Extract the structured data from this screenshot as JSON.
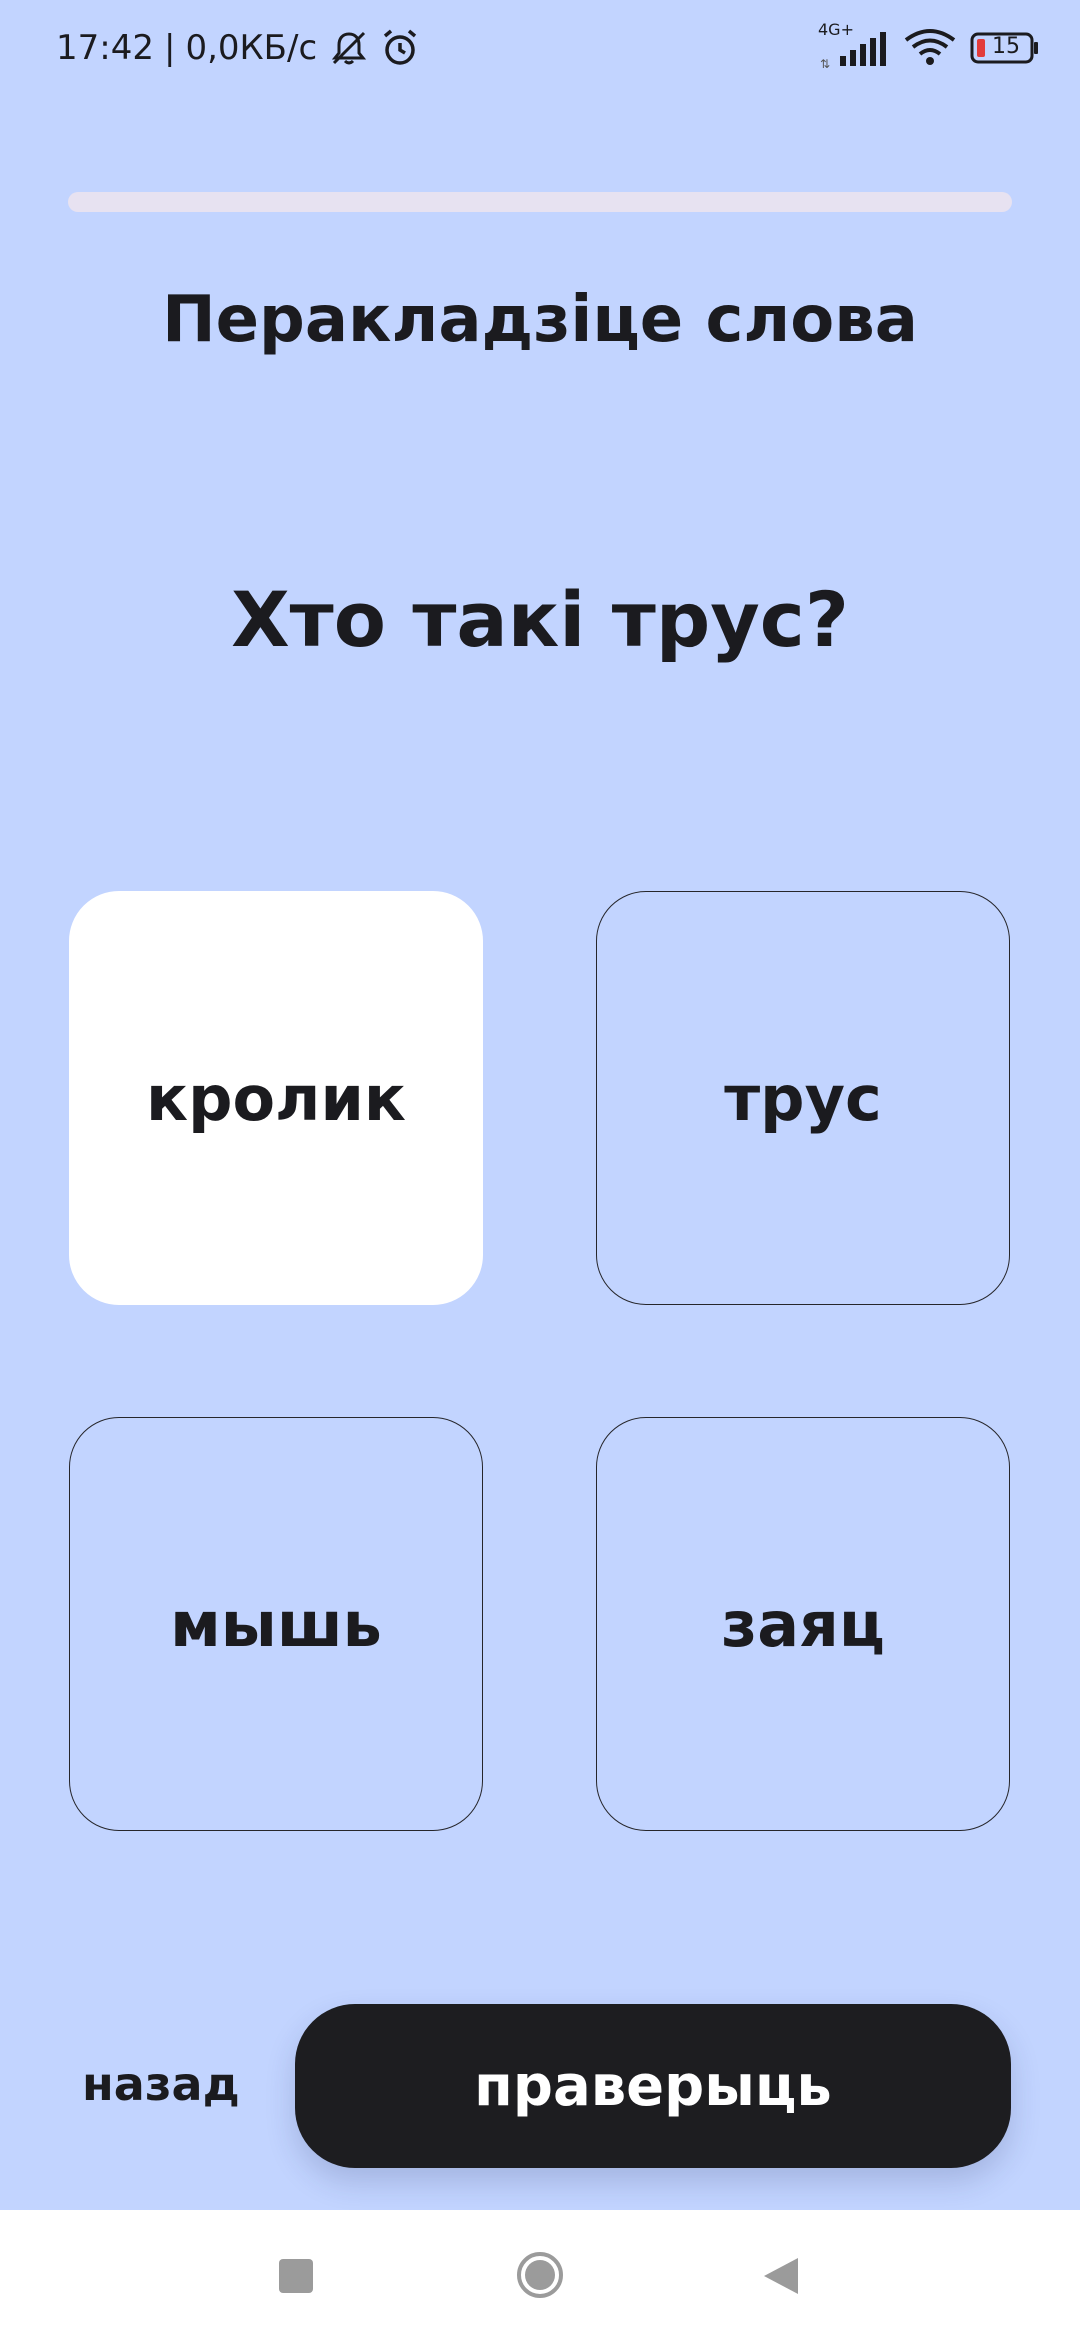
{
  "status_bar": {
    "time": "17:42",
    "separator": "|",
    "speed": "0,0КБ/с",
    "network_type": "4G+",
    "battery_level": "15",
    "icons": [
      "bell-off-icon",
      "alarm-icon",
      "signal-icon",
      "wifi-icon",
      "battery-icon"
    ]
  },
  "progress": {
    "value": 0
  },
  "instruction": "Перакладзіце слова",
  "question": "Хто такі трус?",
  "options": [
    {
      "label": "кролик",
      "selected": true
    },
    {
      "label": "трус",
      "selected": false
    },
    {
      "label": "мышь",
      "selected": false
    },
    {
      "label": "заяц",
      "selected": false
    }
  ],
  "footer": {
    "back_label": "назад",
    "check_label": "праверыць"
  },
  "nav_bar": {
    "icons": [
      "recents-icon",
      "home-icon",
      "back-icon"
    ]
  },
  "colors": {
    "background": "#c2d4ff",
    "button": "#1d1d20",
    "selected_option": "#ffffff",
    "progress_track": "#e7e2f1"
  }
}
